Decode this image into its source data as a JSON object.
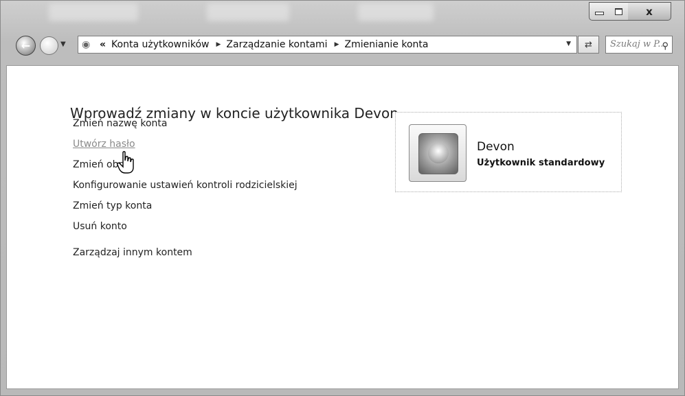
{
  "window": {
    "minimize_icon": "minimize-icon",
    "maximize_icon": "maximize-icon",
    "close_label": "x"
  },
  "navigation": {
    "back_icon": "back-arrow-icon",
    "forward_icon": "forward-arrow-icon",
    "address_icon": "users-icon",
    "overflow_label": "«",
    "breadcrumbs": [
      "Konta użytkowników",
      "Zarządzanie kontami",
      "Zmienianie konta"
    ],
    "refresh_icon": "refresh-icon",
    "search_placeholder": "Szukaj w P..."
  },
  "page": {
    "title": "Wprowadź zmiany w koncie użytkownika Devon",
    "tasks": [
      "Zmień nazwę konta",
      "Utwórz hasło",
      "Zmień obraz",
      "Konfigurowanie ustawień kontroli rodzicielskiej",
      "Zmień typ konta",
      "Usuń konto",
      "Zarządzaj innym kontem"
    ],
    "hovered_task_index": 1
  },
  "user_card": {
    "name": "Devon",
    "account_type": "Użytkownik standardowy"
  }
}
